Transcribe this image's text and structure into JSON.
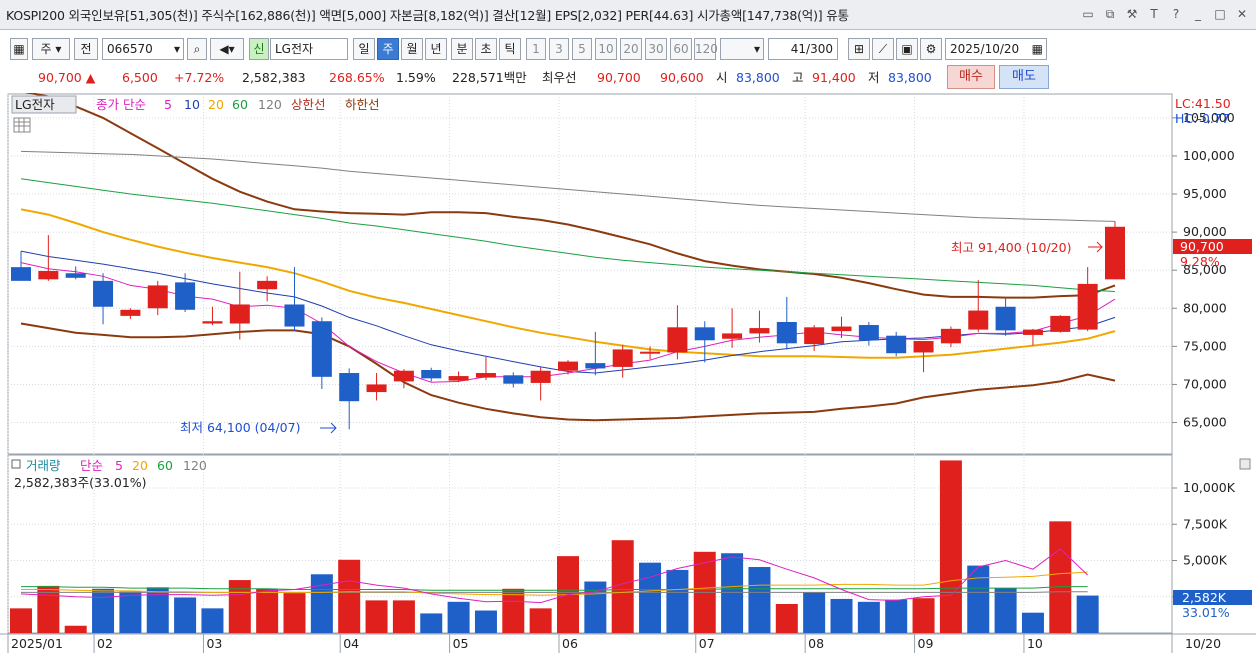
{
  "titlebar": {
    "info": "KOSPI200 외국인보유[51,305(천)] 주식수[162,886(천)] 액면[5,000] 자본금[8,182(억)] 결산[12월] EPS[2,032] PER[44.63] 시가총액[147,738(억)] 유통",
    "icons": [
      "window-icon",
      "copy-icon",
      "tool-icon",
      "text-icon",
      "help-icon",
      "minimize-icon",
      "maximize-icon",
      "close-icon"
    ]
  },
  "toolbar": {
    "mode": "주",
    "jeon": "전",
    "code": "066570",
    "badge": "신",
    "name": "LG전자",
    "periods": [
      "일",
      "주",
      "월",
      "년"
    ],
    "active_period": "주",
    "intervals": [
      "분",
      "초",
      "틱"
    ],
    "numbers": [
      "1",
      "3",
      "5",
      "10",
      "20",
      "30",
      "60",
      "120"
    ],
    "count": "41",
    "count_total": "/300",
    "date": "2025/10/20"
  },
  "quote": {
    "price": "90,700",
    "change": "6,500",
    "change_pct": "+7.72%",
    "volume": "2,582,383",
    "vol_ratio": "268.65%",
    "turnover": "1.59%",
    "amount": "228,571백만",
    "best_label": "최우선",
    "best_ask": "90,700",
    "best_bid": "90,600",
    "open_label": "시",
    "open": "83,800",
    "high_label": "고",
    "high": "91,400",
    "low_label": "저",
    "low": "83,800",
    "buy": "매수",
    "sell": "매도"
  },
  "price_panel": {
    "legend": {
      "name": "LG전자",
      "series": "종가 단순",
      "ma": [
        "5",
        "10",
        "20",
        "60",
        "120"
      ],
      "upper": "상한선",
      "lower": "하한선"
    },
    "lc": "LC:41.50",
    "hc": "HC:-0.77",
    "high_annotation": "최고 91,400 (10/20)",
    "low_annotation": "최저 64,100 (04/07)",
    "last_price": "90,700",
    "last_pct": "9.28%"
  },
  "volume_panel": {
    "legend": {
      "name": "거래량",
      "series": "단순",
      "ma": [
        "5",
        "20",
        "60",
        "120"
      ]
    },
    "current": "2,582,383주(33.01%)",
    "last_vol": "2,582K",
    "last_pct": "33.01%"
  },
  "colors": {
    "up": "#e0201c",
    "down": "#1f5fc8",
    "ma5": "#e020c0",
    "ma10": "#1f3fb0",
    "ma20": "#f0a800",
    "ma60": "#1aa040",
    "ma120": "#808080",
    "band": "#8b3a10"
  },
  "chart_data": [
    {
      "type": "candlestick",
      "x_labels": [
        "2025/01",
        "02",
        "03",
        "04",
        "05",
        "06",
        "07",
        "08",
        "09",
        "10",
        "10/20"
      ],
      "y_ticks": [
        65000,
        70000,
        75000,
        80000,
        85000,
        90000,
        95000,
        100000,
        105000
      ],
      "ylim": [
        61000,
        108000
      ],
      "candles": [
        {
          "o": 85400,
          "h": 87500,
          "l": 83800,
          "c": 83600
        },
        {
          "o": 83800,
          "h": 89600,
          "l": 83600,
          "c": 84900
        },
        {
          "o": 84600,
          "h": 85500,
          "l": 83800,
          "c": 84000
        },
        {
          "o": 83600,
          "h": 84600,
          "l": 77900,
          "c": 80200
        },
        {
          "o": 79000,
          "h": 80000,
          "l": 78600,
          "c": 79800
        },
        {
          "o": 80000,
          "h": 83600,
          "l": 79100,
          "c": 83000
        },
        {
          "o": 83400,
          "h": 84600,
          "l": 79500,
          "c": 79800
        },
        {
          "o": 78000,
          "h": 80200,
          "l": 77800,
          "c": 78300
        },
        {
          "o": 78000,
          "h": 84800,
          "l": 75900,
          "c": 80500
        },
        {
          "o": 82500,
          "h": 84200,
          "l": 80900,
          "c": 83600
        },
        {
          "o": 80500,
          "h": 85400,
          "l": 77000,
          "c": 77600
        },
        {
          "o": 78300,
          "h": 78800,
          "l": 69400,
          "c": 71000
        },
        {
          "o": 71500,
          "h": 72100,
          "l": 64100,
          "c": 67800
        },
        {
          "o": 69000,
          "h": 71500,
          "l": 67900,
          "c": 70000
        },
        {
          "o": 70400,
          "h": 72000,
          "l": 69500,
          "c": 71800
        },
        {
          "o": 71900,
          "h": 72200,
          "l": 70400,
          "c": 70800
        },
        {
          "o": 70500,
          "h": 71700,
          "l": 70300,
          "c": 71100
        },
        {
          "o": 70900,
          "h": 73600,
          "l": 70600,
          "c": 71500
        },
        {
          "o": 71200,
          "h": 71600,
          "l": 69600,
          "c": 70100
        },
        {
          "o": 70200,
          "h": 72300,
          "l": 67900,
          "c": 71800
        },
        {
          "o": 71800,
          "h": 73200,
          "l": 71300,
          "c": 73000
        },
        {
          "o": 72800,
          "h": 76900,
          "l": 71200,
          "c": 72100
        },
        {
          "o": 72300,
          "h": 75200,
          "l": 70900,
          "c": 74600
        },
        {
          "o": 74100,
          "h": 75000,
          "l": 73300,
          "c": 74300
        },
        {
          "o": 74200,
          "h": 80400,
          "l": 73300,
          "c": 77500
        },
        {
          "o": 77500,
          "h": 78300,
          "l": 72900,
          "c": 75800
        },
        {
          "o": 76000,
          "h": 80000,
          "l": 74800,
          "c": 76700
        },
        {
          "o": 76700,
          "h": 79700,
          "l": 75500,
          "c": 77400
        },
        {
          "o": 78200,
          "h": 81500,
          "l": 74600,
          "c": 75400
        },
        {
          "o": 75300,
          "h": 77800,
          "l": 74400,
          "c": 77500
        },
        {
          "o": 77000,
          "h": 78900,
          "l": 76100,
          "c": 77600
        },
        {
          "o": 77800,
          "h": 78200,
          "l": 75100,
          "c": 75800
        },
        {
          "o": 76400,
          "h": 76900,
          "l": 73700,
          "c": 74100
        },
        {
          "o": 74200,
          "h": 75400,
          "l": 71600,
          "c": 75700
        },
        {
          "o": 75400,
          "h": 77600,
          "l": 74900,
          "c": 77300
        },
        {
          "o": 77200,
          "h": 83700,
          "l": 76900,
          "c": 79700
        },
        {
          "o": 80200,
          "h": 81500,
          "l": 76400,
          "c": 77100
        },
        {
          "o": 76500,
          "h": 77300,
          "l": 75100,
          "c": 77200
        },
        {
          "o": 76900,
          "h": 79100,
          "l": 76800,
          "c": 79000
        },
        {
          "o": 77200,
          "h": 85400,
          "l": 77000,
          "c": 83200
        },
        {
          "o": 83800,
          "h": 91400,
          "l": 83800,
          "c": 90700
        }
      ],
      "ma5": [
        86000,
        85200,
        84800,
        84200,
        83000,
        82500,
        81600,
        81200,
        80200,
        80400,
        80000,
        78000,
        75000,
        73000,
        71500,
        70300,
        70400,
        71000,
        71000,
        71000,
        71500,
        72100,
        72700,
        73200,
        74300,
        75000,
        75800,
        76200,
        76500,
        76900,
        76500,
        76200,
        76000,
        75900,
        76200,
        76700,
        76700,
        77000,
        78000,
        79000,
        81200
      ],
      "ma10": [
        87500,
        86800,
        86300,
        85800,
        85200,
        84600,
        83900,
        83200,
        82600,
        82000,
        81500,
        80300,
        78800,
        77700,
        76400,
        75200,
        74400,
        73700,
        73000,
        72300,
        71700,
        71500,
        71900,
        72300,
        72700,
        73200,
        73800,
        74300,
        74700,
        75100,
        75600,
        75800,
        76000,
        76100,
        76400,
        76700,
        76600,
        76800,
        77200,
        77600,
        78800
      ],
      "ma20": [
        93000,
        92300,
        91200,
        90000,
        89000,
        88100,
        87300,
        86600,
        86000,
        85400,
        84600,
        83500,
        82300,
        81400,
        80700,
        79900,
        79100,
        78300,
        77500,
        76800,
        76200,
        75600,
        75100,
        74600,
        74300,
        74100,
        73900,
        73700,
        73700,
        73700,
        73600,
        73500,
        73500,
        73700,
        73900,
        74300,
        74700,
        75100,
        75500,
        76000,
        77000
      ],
      "ma60": [
        97000,
        96500,
        96000,
        95500,
        95000,
        94600,
        94200,
        93800,
        93300,
        92800,
        92300,
        91800,
        91200,
        90800,
        90300,
        89800,
        89300,
        88800,
        88200,
        87700,
        87200,
        86700,
        86300,
        86000,
        85700,
        85400,
        85200,
        85000,
        84800,
        84600,
        84400,
        84200,
        84000,
        83800,
        83600,
        83400,
        83200,
        83000,
        82700,
        82400,
        82200
      ],
      "ma120": [
        100600,
        100500,
        100400,
        100300,
        100200,
        100000,
        99800,
        99600,
        99300,
        99000,
        98700,
        98400,
        98000,
        97700,
        97400,
        97100,
        96800,
        96500,
        96200,
        95900,
        95600,
        95300,
        95000,
        94700,
        94400,
        94100,
        93800,
        93500,
        93300,
        93100,
        92900,
        92700,
        92500,
        92300,
        92100,
        91900,
        91800,
        91700,
        91600,
        91500,
        91400
      ],
      "upper": [
        108500,
        107800,
        106500,
        105000,
        103000,
        101000,
        99000,
        97000,
        95300,
        94000,
        93000,
        92700,
        92500,
        92400,
        92300,
        92600,
        92600,
        92500,
        92000,
        91600,
        91000,
        90200,
        89300,
        88400,
        87200,
        86200,
        85600,
        85100,
        84800,
        84500,
        84000,
        83300,
        82500,
        81800,
        81500,
        81500,
        81400,
        81400,
        81600,
        81700,
        83000
      ],
      "lower": [
        78000,
        77400,
        76800,
        76500,
        76200,
        76200,
        76300,
        76600,
        76900,
        77100,
        77100,
        76600,
        75000,
        72700,
        70300,
        68600,
        67600,
        66800,
        66200,
        65700,
        65400,
        65300,
        65400,
        65500,
        65600,
        65800,
        66000,
        66200,
        66300,
        66400,
        66800,
        67100,
        67500,
        68300,
        68800,
        69300,
        69600,
        69900,
        70400,
        71300,
        70500
      ]
    },
    {
      "type": "bar",
      "title": "거래량",
      "y_ticks": [
        2500,
        5000,
        7500,
        10000
      ],
      "ylim": [
        0,
        12000
      ],
      "volumes": [
        1700,
        3250,
        500,
        3050,
        2850,
        3150,
        2450,
        1700,
        3650,
        3050,
        2750,
        4050,
        5050,
        2250,
        2250,
        1350,
        2150,
        1550,
        3050,
        1700,
        5300,
        3550,
        6400,
        4850,
        4350,
        5600,
        5500,
        4550,
        2000,
        2800,
        2350,
        2150,
        2300,
        2400,
        11900,
        4650,
        3100,
        1400,
        7700,
        2582
      ],
      "up": [
        true,
        true,
        true,
        false,
        false,
        false,
        false,
        false,
        true,
        true,
        true,
        false,
        true,
        true,
        true,
        false,
        false,
        false,
        true,
        true,
        true,
        false,
        true,
        false,
        false,
        true,
        false,
        false,
        true,
        false,
        false,
        false,
        false,
        true,
        true,
        false,
        false,
        false,
        true,
        false
      ],
      "vma5": [
        2700,
        2600,
        2500,
        2450,
        2600,
        2650,
        2650,
        2600,
        2650,
        2900,
        3000,
        3300,
        3600,
        3300,
        3100,
        2700,
        2400,
        2150,
        2200,
        2100,
        2650,
        2850,
        3400,
        3850,
        4450,
        4850,
        5250,
        5050,
        4400,
        3800,
        3000,
        2300,
        2250,
        2500,
        2600,
        4550,
        5000,
        4400,
        5800,
        4000
      ],
      "vma20": [
        3000,
        3000,
        2950,
        2900,
        2900,
        2850,
        2850,
        2800,
        2800,
        2800,
        2800,
        2800,
        2850,
        2850,
        2850,
        2750,
        2700,
        2650,
        2650,
        2600,
        2650,
        2700,
        2800,
        2900,
        3000,
        3100,
        3200,
        3300,
        3300,
        3300,
        3350,
        3350,
        3300,
        3300,
        3600,
        3800,
        3850,
        3900,
        4100,
        4200
      ],
      "vma60": [
        3200,
        3200,
        3150,
        3150,
        3100,
        3100,
        3100,
        3050,
        3050,
        3050,
        3000,
        3000,
        3000,
        3000,
        3000,
        2950,
        2950,
        2950,
        2950,
        2950,
        2950,
        2950,
        3000,
        3000,
        3000,
        3000,
        3050,
        3050,
        3050,
        3050,
        3050,
        3050,
        3050,
        3050,
        3100,
        3100,
        3100,
        3100,
        3200,
        3200
      ],
      "vma120": [
        2800,
        2800,
        2800,
        2800,
        2800,
        2800,
        2800,
        2800,
        2800,
        2800,
        2800,
        2800,
        2800,
        2800,
        2800,
        2800,
        2800,
        2800,
        2800,
        2800,
        2800,
        2800,
        2800,
        2800,
        2800,
        2800,
        2800,
        2800,
        2800,
        2800,
        2800,
        2800,
        2800,
        2800,
        2800,
        2800,
        2800,
        2800,
        2850,
        2850
      ]
    }
  ]
}
